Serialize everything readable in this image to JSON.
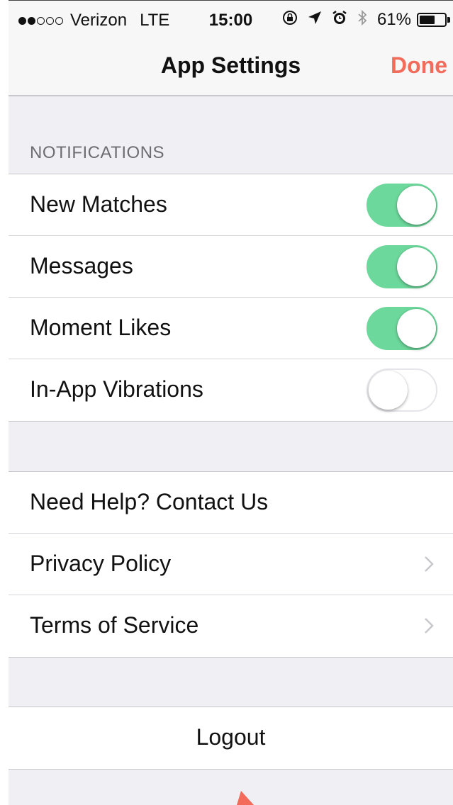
{
  "status_bar": {
    "signal_total": 5,
    "signal_filled": 2,
    "carrier": "Verizon",
    "network": "LTE",
    "time": "15:00",
    "icons": [
      "rotation-lock-icon",
      "location-icon",
      "alarm-icon",
      "bluetooth-icon"
    ],
    "battery_percent": "61%",
    "battery_level": 0.61
  },
  "nav": {
    "title": "App Settings",
    "done_label": "Done"
  },
  "notifications": {
    "header": "NOTIFICATIONS",
    "items": [
      {
        "label": "New Matches",
        "on": true
      },
      {
        "label": "Messages",
        "on": true
      },
      {
        "label": "Moment Likes",
        "on": true
      },
      {
        "label": "In-App Vibrations",
        "on": false
      }
    ]
  },
  "support": {
    "items": [
      {
        "label": "Need Help? Contact Us",
        "chevron": false
      },
      {
        "label": "Privacy Policy",
        "chevron": true
      },
      {
        "label": "Terms of Service",
        "chevron": true
      }
    ]
  },
  "account": {
    "logout_label": "Logout"
  },
  "colors": {
    "accent": "#f26b5b",
    "toggle_on": "#6cd89b",
    "background": "#efeff4"
  }
}
